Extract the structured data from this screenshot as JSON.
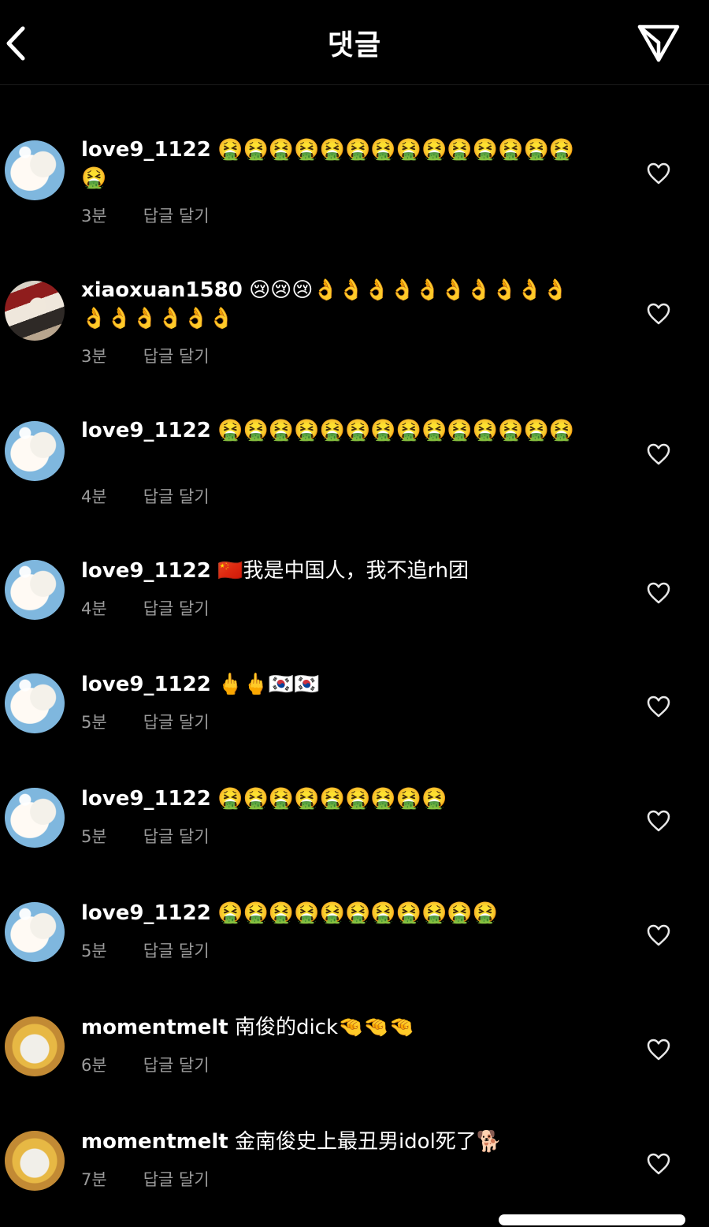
{
  "header": {
    "title": "댓글",
    "back_icon": "chevron-left-icon",
    "share_icon": "paper-plane-icon"
  },
  "comments": [
    {
      "username": "love9_1122",
      "text": "🤮🤮🤮🤮🤮🤮🤮🤮🤮🤮🤮🤮🤮🤮🤮",
      "time": "3분",
      "reply": "답글 달기"
    },
    {
      "username": "xiaoxuan1580",
      "text": "😢😢😢👌👌👌👌👌👌👌👌👌👌👌👌👌👌👌👌",
      "time": "3분",
      "reply": "답글 달기"
    },
    {
      "username": "love9_1122",
      "text": "🤮🤮🤮🤮🤮🤮🤮🤮🤮🤮🤮🤮🤮🤮",
      "time": "4분",
      "reply": "답글 달기"
    },
    {
      "username": "love9_1122",
      "text": "🇨🇳我是中国人，我不追rh团",
      "time": "4분",
      "reply": "답글 달기"
    },
    {
      "username": "love9_1122",
      "text": "🖕🖕🇰🇷🇰🇷",
      "time": "5분",
      "reply": "답글 달기"
    },
    {
      "username": "love9_1122",
      "text": "🤮🤮🤮🤮🤮🤮🤮🤮🤮",
      "time": "5분",
      "reply": "답글 달기"
    },
    {
      "username": "love9_1122",
      "text": "🤮🤮🤮🤮🤮🤮🤮🤮🤮🤮🤮",
      "time": "5분",
      "reply": "답글 달기"
    },
    {
      "username": "momentmelt",
      "text": "南俊的dick🤏🤏🤏",
      "time": "6분",
      "reply": "답글 달기"
    },
    {
      "username": "momentmelt",
      "text": "金南俊史上最丑男idol死了🐕",
      "time": "7분",
      "reply": "답글 달기"
    }
  ]
}
